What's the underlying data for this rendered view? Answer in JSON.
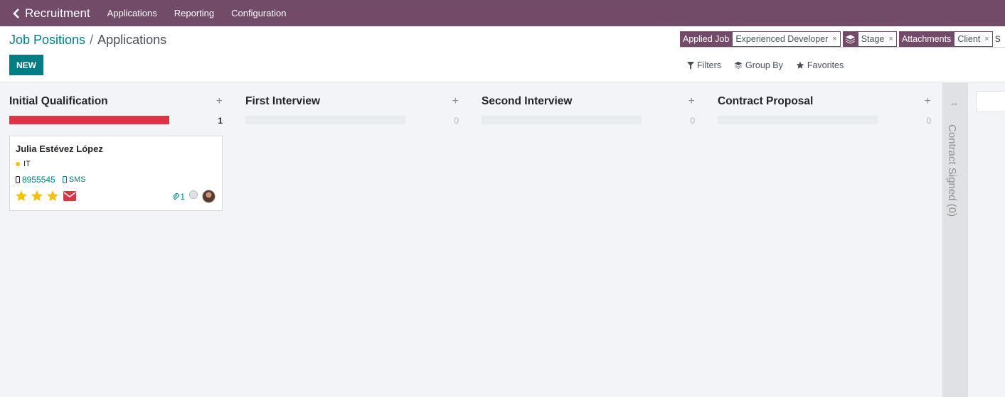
{
  "nav": {
    "app": "Recruitment",
    "menus": [
      "Applications",
      "Reporting",
      "Configuration"
    ]
  },
  "breadcrumb": {
    "parent": "Job Positions",
    "separator": "/",
    "current": "Applications"
  },
  "new_button": "NEW",
  "search": {
    "facets": [
      {
        "label": "Applied Job",
        "value": "Experienced Developer"
      },
      {
        "icon": "layers-icon",
        "value": "Stage"
      },
      {
        "label": "Attachments",
        "value": "Client"
      }
    ],
    "overflow_text": "S"
  },
  "filters": {
    "filters": "Filters",
    "group_by": "Group By",
    "favorites": "Favorites"
  },
  "columns": [
    {
      "title": "Initial Qualification",
      "count": "1",
      "fill": 1.0
    },
    {
      "title": "First Interview",
      "count": "0",
      "fill": 0
    },
    {
      "title": "Second Interview",
      "count": "0",
      "fill": 0
    },
    {
      "title": "Contract Proposal",
      "count": "0",
      "fill": 0
    }
  ],
  "card": {
    "name": "Julia Estévez López",
    "tag": "IT",
    "phone": "8955545",
    "sms": "SMS",
    "stars": 3,
    "attachments": "1"
  },
  "folded_column": {
    "label": "Contract Signed (0)"
  },
  "colors": {
    "navbar": "#714b67",
    "primary": "#017e84",
    "danger": "#dc3545",
    "star": "#f4c20d"
  }
}
